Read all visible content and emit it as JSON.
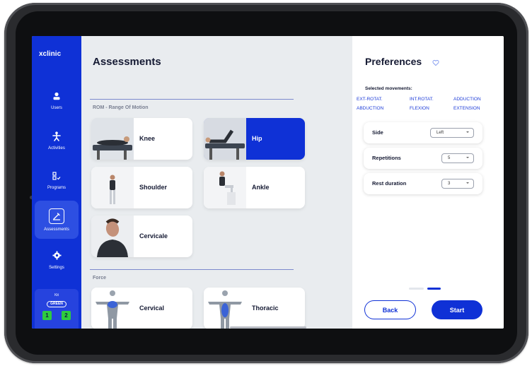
{
  "sidebar": {
    "brand": "xclinic",
    "items": [
      {
        "label": "Users",
        "icon": "user-icon"
      },
      {
        "label": "Activities",
        "icon": "activities-icon"
      },
      {
        "label": "Programs",
        "icon": "programs-icon"
      },
      {
        "label": "Assessments",
        "icon": "assessments-icon",
        "active": true
      },
      {
        "label": "Settings",
        "icon": "settings-icon"
      }
    ],
    "kit": {
      "label": "Kit",
      "badge": "GREEN",
      "chips": [
        "1",
        "2"
      ],
      "chip_color": "#2ecc40"
    }
  },
  "main": {
    "title": "Assessments",
    "sections": [
      {
        "label": "ROM - Range Of Motion",
        "cards": [
          {
            "name": "Knee",
            "selected": false
          },
          {
            "name": "Hip",
            "selected": true
          },
          {
            "name": "Shoulder",
            "selected": false
          },
          {
            "name": "Ankle",
            "selected": false
          },
          {
            "name": "Cervicale",
            "selected": false
          }
        ]
      },
      {
        "label": "Force",
        "cards": [
          {
            "name": "Cervical",
            "selected": false
          },
          {
            "name": "Thoracic",
            "selected": false
          }
        ]
      }
    ]
  },
  "preferences": {
    "title": "Preferences",
    "selected_label": "Selected movements:",
    "movements": [
      "EXT-ROTAT.",
      "INT.ROTAT.",
      "ADDUCTION",
      "ABDUCTION",
      "FLEXION",
      "EXTENSION"
    ],
    "options": [
      {
        "label": "Side",
        "value": "Left"
      },
      {
        "label": "Repetitions",
        "value": "5"
      },
      {
        "label": "Rest duration",
        "value": "3"
      }
    ],
    "back_label": "Back",
    "start_label": "Start"
  },
  "colors": {
    "accent": "#0f31d6",
    "background": "#e9ecef"
  }
}
